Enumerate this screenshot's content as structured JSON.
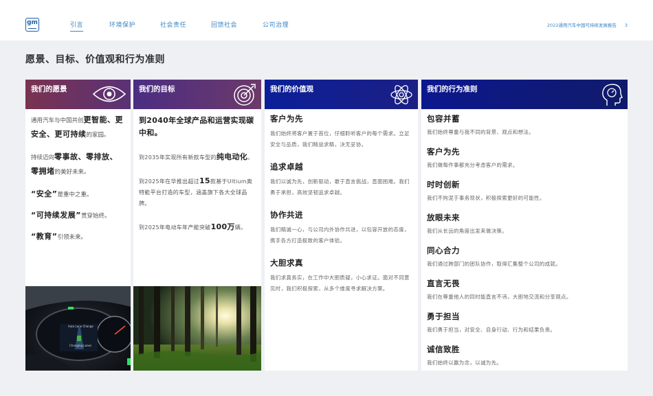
{
  "header": {
    "logo_text": "gm",
    "nav": [
      "引言",
      "环境保护",
      "社会责任",
      "回馈社会",
      "公司治理"
    ],
    "active_nav": "引言",
    "report_title": "2022通用汽车中国可持续发展报告",
    "page_number": "3"
  },
  "page_title": "愿景、目标、价值观和行为准则",
  "vision": {
    "title": "我们的愿景",
    "icon": "eye-icon",
    "p1_a": "通用汽车与中国共创",
    "p1_b": "更智能、更安全、更可持续",
    "p1_c": "的家园。",
    "p2_a": "持续迈向",
    "p2_b": "零事故、零排放、零拥堵",
    "p2_c": "的美好未来。",
    "q1_b": "“安全”",
    "q1_c": "是重中之重。",
    "q2_b": "“可持续发展”",
    "q2_c": "贯穿始终。",
    "q3_b": "“教育”",
    "q3_c": "引领未来。"
  },
  "goals": {
    "title": "我们的目标",
    "icon": "target-icon",
    "lead": "到2040年全球产品和运营实现碳中和。",
    "p1_a": "到2035年实现所有新款车型的",
    "p1_b": "纯电动化",
    "p1_c": "。",
    "p2_a": "到2025年在华推出超过",
    "p2_b": "15",
    "p2_c": "款基于Ultium奥特能平台打造的车型，涵盖旗下各大全球品牌。",
    "p3_a": "到2025年电动车年产能突破",
    "p3_b": "100万",
    "p3_c": "辆。"
  },
  "values": {
    "title": "我们的价值观",
    "icon": "atom-icon",
    "items": [
      {
        "title": "客户为先",
        "text": "我们始终将客户置于首位，仔细聆听客户的每个需求。立足安全与品质，我们精益求精，决无妥协。"
      },
      {
        "title": "追求卓越",
        "text": "我们以诚为先，创新驱动，敢于直言挑战，直面困难。我们勇于承担，高效坚韧追求卓越。"
      },
      {
        "title": "协作共进",
        "text": "我们精诚一心，与公司内外协作共进，以包容开放的态度，携手各方打造极致的客户体验。"
      },
      {
        "title": "大胆求真",
        "text": "我们求真务实，在工作中大胆质疑，小心求证。面对不同意见时，我们积极探索，从多个维度寻求解决方案。"
      }
    ]
  },
  "conduct": {
    "title": "我们的行为准则",
    "icon": "head-icon",
    "items": [
      {
        "title": "包容并蓄",
        "text": "我们始终尊重与我不同的背景、观点和想法。"
      },
      {
        "title": "客户为先",
        "text": "我们做每件事都充分考虑客户的需求。"
      },
      {
        "title": "时时创新",
        "text": "我们不拘泥于事务现状，积极探索更好的可能性。"
      },
      {
        "title": "放眼未来",
        "text": "我们从长远的角度出发来做决策。"
      },
      {
        "title": "同心合力",
        "text": "我们通过跨部门的团队协作，取得汇集整个公司的成就。"
      },
      {
        "title": "直言无畏",
        "text": "我们在尊重他人的同时能直言不讳，大胆地交流和分享观点。"
      },
      {
        "title": "勇于担当",
        "text": "我们勇于担当，对安全、自身行动、行为和结果负责。"
      },
      {
        "title": "诚信致胜",
        "text": "我们始终以赢为念，以诚为先。"
      }
    ]
  },
  "dashboard": {
    "label1": "Auto Lane Change",
    "label2": "Changing Lanes"
  }
}
